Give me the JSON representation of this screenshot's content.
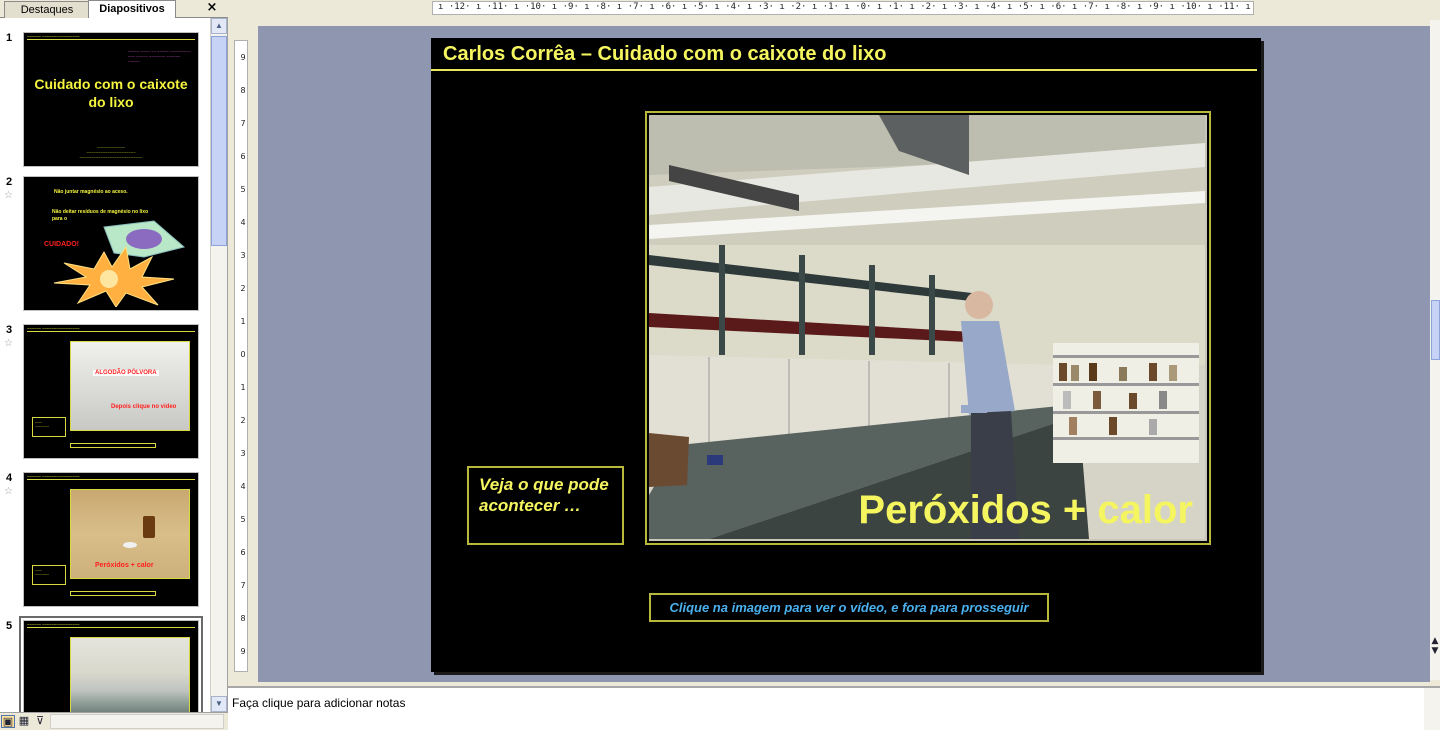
{
  "left_pane": {
    "tabs": [
      {
        "label": "Destaques"
      },
      {
        "label": "Diapositivos"
      }
    ],
    "close_label": "×",
    "thumbnails": [
      {
        "number": "1",
        "title": "Cuidado com o caixote do lixo"
      },
      {
        "number": "2",
        "caption_top": "Não juntar magnésio ao aceso.",
        "caption_mid": "Não deitar resíduos de magnésio no lixo para o",
        "caption_red": "CUIDADO!"
      },
      {
        "number": "3",
        "red_label": "ALGODÃO PÓLVORA",
        "sub_label": "Depois clique no video"
      },
      {
        "number": "4",
        "red_label": "Peróxidos + calor"
      },
      {
        "number": "5"
      }
    ],
    "view_buttons": [
      "normal-view",
      "slide-sorter-view",
      "slideshow-view"
    ]
  },
  "ruler": {
    "horizontal": "ı ·12· ı ·11· ı ·10· ı ·9· ı ·8· ı ·7· ı ·6· ı ·5· ı ·4· ı ·3· ı ·2· ı ·1· ı ·0· ı ·1· ı ·2· ı ·3· ı ·4· ı ·5· ı ·6· ı ·7· ı ·8· ı ·9· ı ·10· ı ·11· ı ·12· ı",
    "vertical": [
      "9",
      "8",
      "7",
      "6",
      "5",
      "4",
      "3",
      "2",
      "1",
      "0",
      "1",
      "2",
      "3",
      "4",
      "5",
      "6",
      "7",
      "8",
      "9"
    ]
  },
  "slide": {
    "title": "Carlos Corrêa – Cuidado com o caixote do lixo",
    "photo_overlay": "Peróxidos + calor",
    "veja_text": "Veja o que pode acontecer …",
    "video_link": "Clique na imagem para ver o vídeo, e fora para prosseguir"
  },
  "notes": {
    "placeholder": "Faça clique para adicionar notas"
  },
  "colors": {
    "slide_text_yellow": "#f5f560",
    "link_blue": "#4ab0ee",
    "frame_olive": "#b8b83a",
    "workspace_bg": "#8e96b0"
  }
}
